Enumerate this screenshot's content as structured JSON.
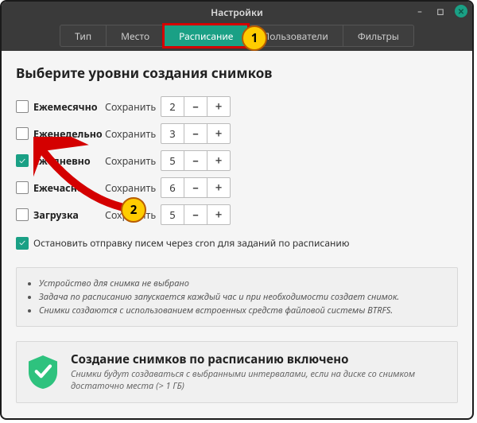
{
  "window": {
    "title": "Настройки"
  },
  "tabs": [
    {
      "label": "Тип",
      "active": false
    },
    {
      "label": "Место",
      "active": false
    },
    {
      "label": "Расписание",
      "active": true
    },
    {
      "label": "Пользователи",
      "active": false
    },
    {
      "label": "Фильтры",
      "active": false
    }
  ],
  "heading": "Выберите уровни создания снимков",
  "rows": [
    {
      "label": "Ежемесячно",
      "checked": false,
      "save": "Сохранить",
      "value": "2"
    },
    {
      "label": "Еженедельно",
      "checked": false,
      "save": "Сохранить",
      "value": "3"
    },
    {
      "label": "Ежедневно",
      "checked": true,
      "save": "Сохранить",
      "value": "5"
    },
    {
      "label": "Ежечасно",
      "checked": false,
      "save": "Сохранить",
      "value": "6"
    },
    {
      "label": "Загрузка",
      "checked": false,
      "save": "Сохранить",
      "value": "5"
    }
  ],
  "stop_email": {
    "checked": true,
    "label": "Остановить отправку писем через cron для заданий по расписанию"
  },
  "info": {
    "items": [
      "Устройство для снимка не выбрано",
      "Задача по расписанию запускается каждый час и при необходимости создает снимок.",
      "Снимки создаются с использованием встроенных средств файловой системы BTRFS."
    ]
  },
  "status": {
    "title": "Создание снимков по расписанию включено",
    "desc": "Снимки будут создаваться с выбранными интервалами, если на диске со снимком достаточно места (> 1 ГБ)"
  },
  "markers": {
    "m1": "1",
    "m2": "2"
  },
  "colors": {
    "accent": "#1aa085",
    "highlight": "#d40000",
    "marker": "#ffcc00"
  }
}
